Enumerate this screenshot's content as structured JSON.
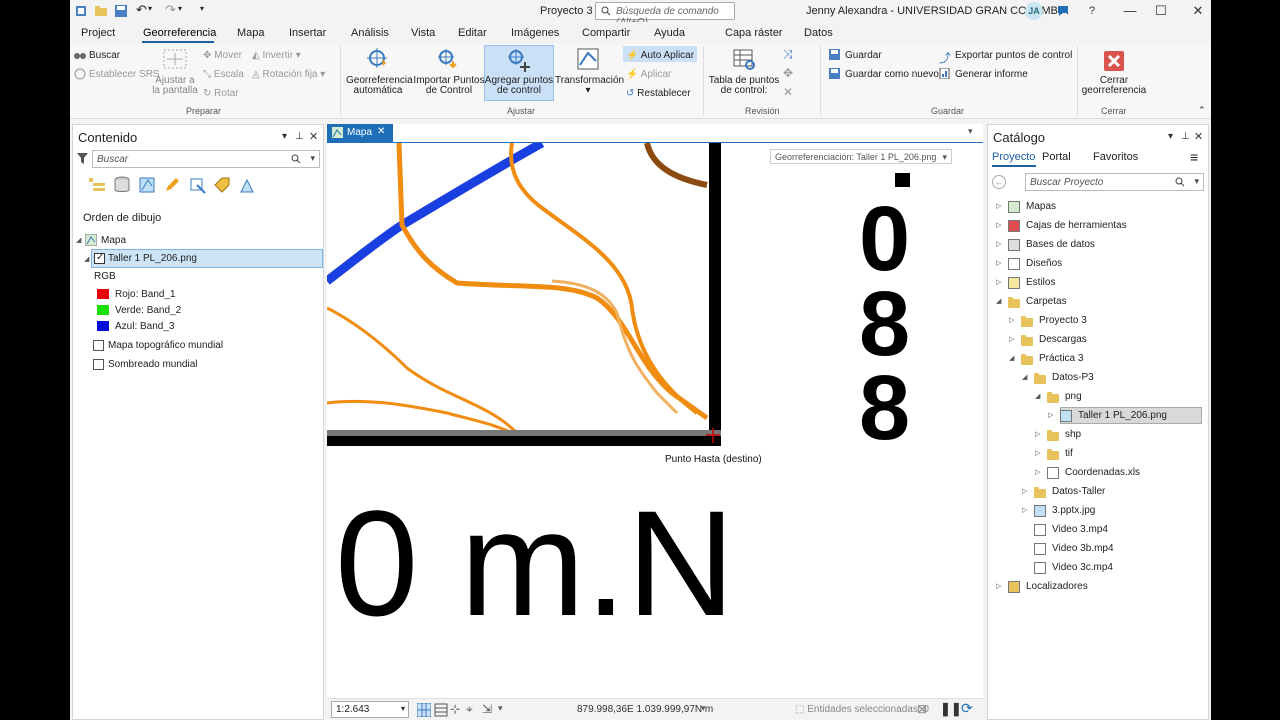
{
  "titlebar": {
    "title": "Proyecto 3",
    "command_search_placeholder": "Búsqueda de comando (Alt+Q)",
    "user": "Jenny Alexandra - UNIVERSIDAD GRAN COLOMBIA",
    "avatar_initials": "JA"
  },
  "menu": {
    "tabs": [
      "Project",
      "Georreferencia",
      "Mapa",
      "Insertar",
      "Análisis",
      "Vista",
      "Editar",
      "Imágenes",
      "Compartir",
      "Ayuda",
      "Capa ráster",
      "Datos"
    ],
    "active": "Georreferencia"
  },
  "ribbon": {
    "preparar": {
      "buscar": "Buscar",
      "establecer_srs": "Establecer SRS",
      "ajustar_pantalla_1": "Ajustar a",
      "ajustar_pantalla_2": "la pantalla",
      "mover": "Mover",
      "escala": "Escala",
      "rotar": "Rotar",
      "invertir": "Invertir",
      "rotacion_fija": "Rotación fija",
      "group": "Preparar"
    },
    "ajustar": {
      "georref_auto_1": "Georreferencia",
      "georref_auto_2": "automática",
      "importar_1": "Importar Puntos",
      "importar_2": "de Control",
      "agregar_1": "Agregar puntos",
      "agregar_2": "de control",
      "transformacion": "Transformación",
      "auto_aplicar": "Auto Aplicar",
      "aplicar": "Aplicar",
      "restablecer": "Restablecer",
      "group": "Ajustar"
    },
    "revision": {
      "tabla_1": "Tabla de puntos",
      "tabla_2": "de control:",
      "group": "Revisión"
    },
    "guardar": {
      "guardar": "Guardar",
      "guardar_nuevo": "Guardar como nuevo",
      "exportar": "Exportar puntos de control",
      "generar": "Generar informe",
      "group": "Guardar"
    },
    "cerrar": {
      "cerrar_1": "Cerrar",
      "cerrar_2": "georreferencia",
      "group": "Cerrar"
    }
  },
  "contents": {
    "title": "Contenido",
    "search_placeholder": "Buscar",
    "drawing_order": "Orden de dibujo",
    "map_name": "Mapa",
    "layer_name": "Taller 1 PL_206.png",
    "rgb": "RGB",
    "bands": [
      {
        "label": "Rojo:  Band_1",
        "color": "#e8000b"
      },
      {
        "label": "Verde: Band_2",
        "color": "#18e000"
      },
      {
        "label": "Azul:  Band_3",
        "color": "#0010d8"
      }
    ],
    "basemaps": [
      "Mapa topográfico mundial",
      "Sombreado mundial"
    ]
  },
  "mapview": {
    "tab_label": "Mapa",
    "georef_combo": "Georreferenciación: Taller 1 PL_206.png",
    "point_label": "Punto Hasta (destino)",
    "scale": "1:2.643",
    "coords": "879.998,36E 1.039.999,97N m",
    "selected": "Entidades seleccionadas: 0",
    "big_text": "0 m.N",
    "side_digits": [
      "0",
      "8",
      "8"
    ]
  },
  "catalog": {
    "title": "Catálogo",
    "tabs": [
      "Proyecto",
      "Portal",
      "Favoritos"
    ],
    "tabs_extra": "Proyecto",
    "search_placeholder": "Buscar Proyecto",
    "items": [
      {
        "label": "Mapas",
        "level": 0
      },
      {
        "label": "Cajas de herramientas",
        "level": 0
      },
      {
        "label": "Bases de datos",
        "level": 0
      },
      {
        "label": "Diseños",
        "level": 0
      },
      {
        "label": "Estilos",
        "level": 0
      },
      {
        "label": "Carpetas",
        "level": 0
      },
      {
        "label": "Proyecto 3",
        "level": 1
      },
      {
        "label": "Descargas",
        "level": 1
      },
      {
        "label": "Práctica 3",
        "level": 1
      },
      {
        "label": "Datos-P3",
        "level": 2
      },
      {
        "label": "png",
        "level": 3
      },
      {
        "label": "Taller 1 PL_206.png",
        "level": 4
      },
      {
        "label": "shp",
        "level": 3
      },
      {
        "label": "tif",
        "level": 3
      },
      {
        "label": "Coordenadas.xls",
        "level": 3
      },
      {
        "label": "Datos-Taller",
        "level": 2
      },
      {
        "label": "3.pptx.jpg",
        "level": 2
      },
      {
        "label": "Video 3.mp4",
        "level": 2
      },
      {
        "label": "Video 3b.mp4",
        "level": 2
      },
      {
        "label": "Video 3c.mp4",
        "level": 2
      },
      {
        "label": "Localizadores",
        "level": 0
      }
    ]
  }
}
